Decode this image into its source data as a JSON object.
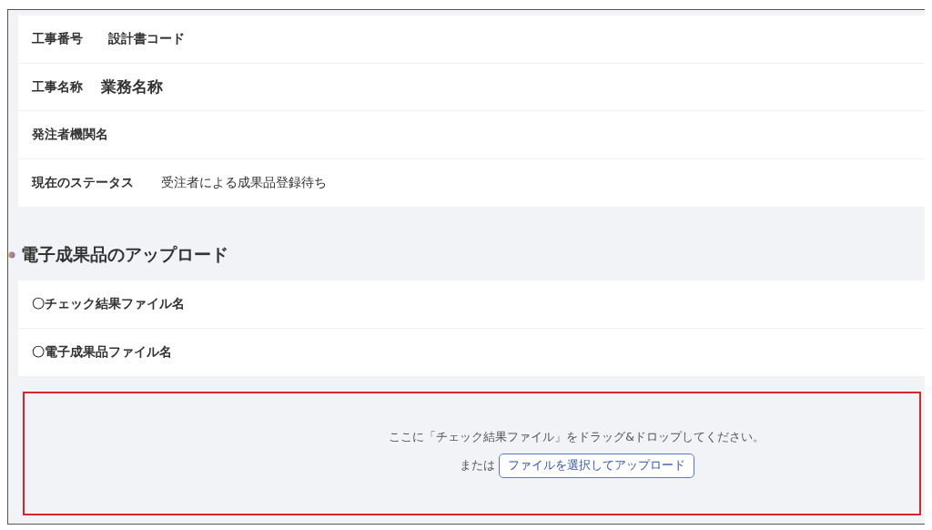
{
  "info_rows": [
    {
      "label": "工事番号",
      "value": "設計書コード",
      "kind": "strong"
    },
    {
      "label": "工事名称",
      "value": "業務名称",
      "kind": "title"
    },
    {
      "label": "発注者機関名"
    },
    {
      "label": "現在のステータス",
      "value": "受注者による成果品登録待ち",
      "kind": "plain"
    }
  ],
  "upload_section": {
    "heading": "電子成果品のアップロード",
    "file_rows": [
      {
        "label": "〇チェック結果ファイル名"
      },
      {
        "label": "〇電子成果品ファイル名"
      }
    ],
    "drop_zone": {
      "instruction": "ここに「チェック結果ファイル」をドラッグ&ドロップしてください。",
      "or_text": "または",
      "button": "ファイルを選択してアップロード",
      "highlighted": true
    }
  }
}
